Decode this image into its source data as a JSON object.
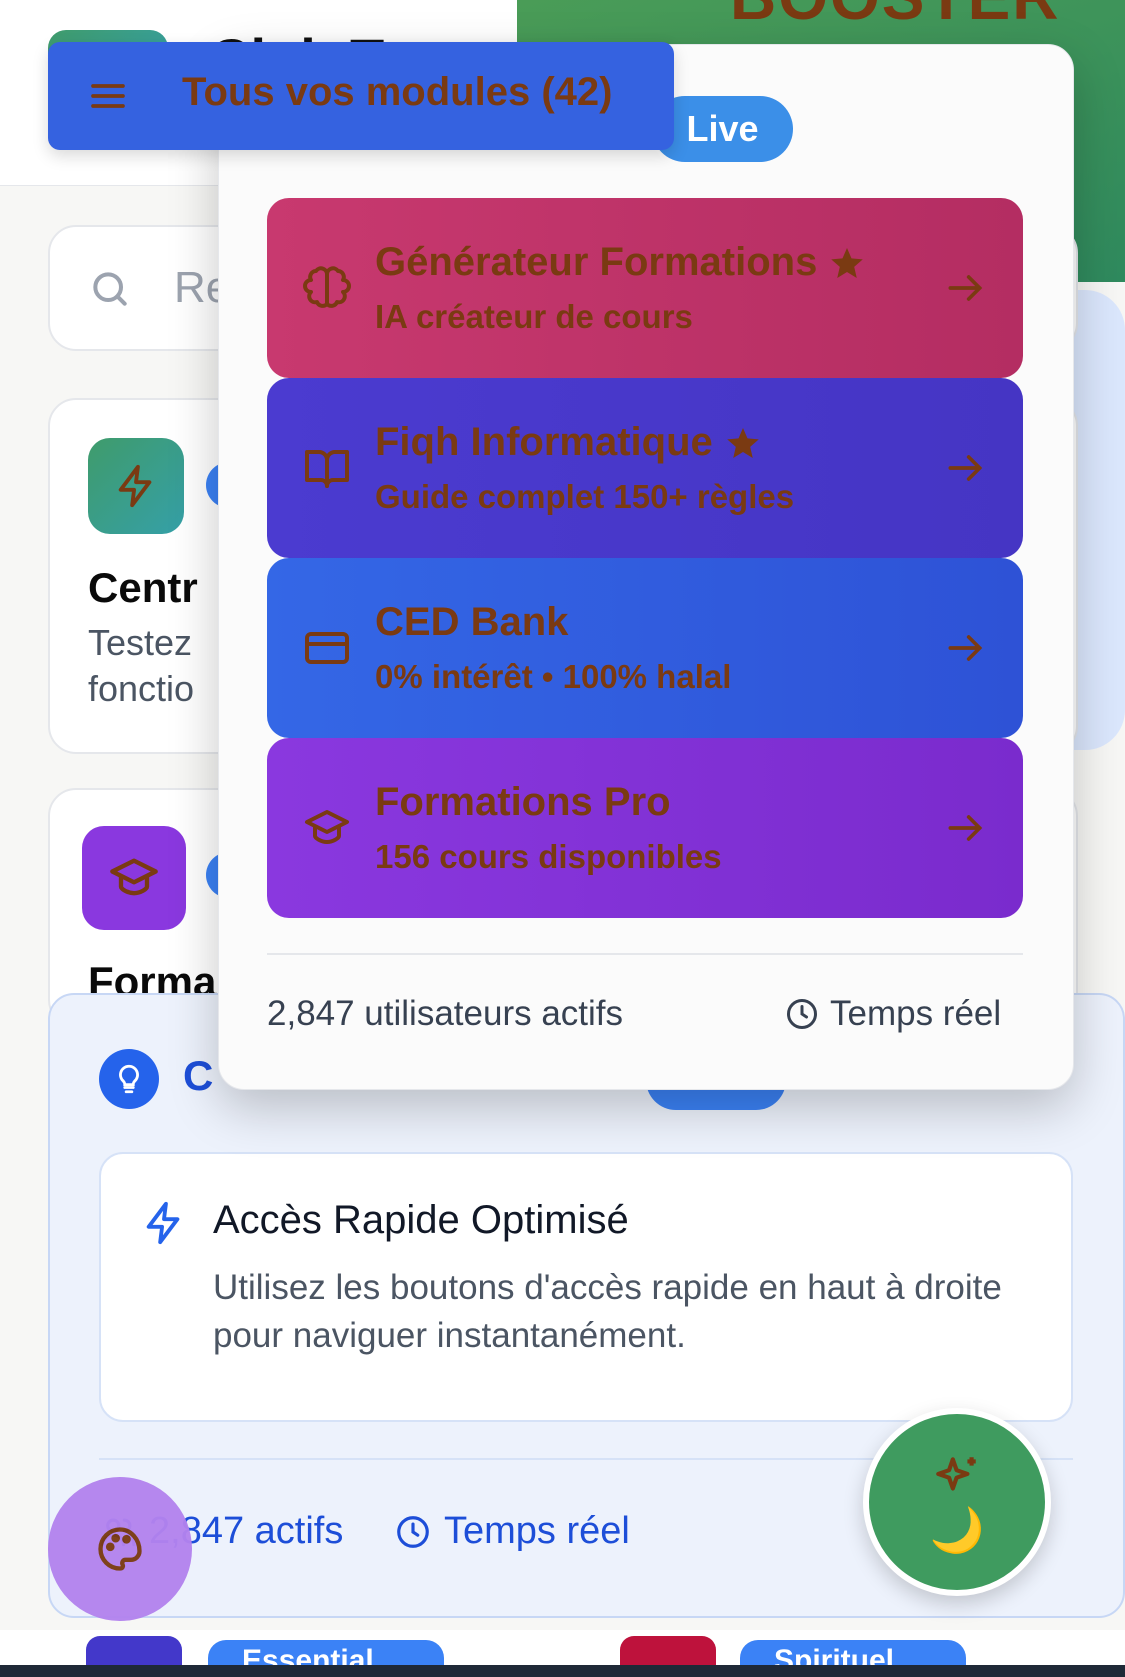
{
  "header": {
    "app_title": "Club T",
    "banner_text": "BOOSTER"
  },
  "search": {
    "placeholder": "Re"
  },
  "cards": [
    {
      "title": "Centr",
      "description": "Testez\nfonctio"
    },
    {
      "title": "Forma"
    }
  ],
  "modules_button": {
    "label": "Tous vos modules (42)"
  },
  "dropdown": {
    "live_badge": "Live",
    "modules": [
      {
        "title": "Générateur Formations",
        "subtitle": "IA créateur de cours",
        "starred": true,
        "icon": "brain-icon"
      },
      {
        "title": "Fiqh Informatique",
        "subtitle": "Guide complet 150+ règles",
        "starred": true,
        "icon": "book-icon"
      },
      {
        "title": "CED Bank",
        "subtitle": "0% intérêt • 100% halal",
        "starred": false,
        "icon": "credit-card-icon"
      },
      {
        "title": "Formations Pro",
        "subtitle": "156 cours disponibles",
        "starred": false,
        "icon": "graduation-cap-icon"
      }
    ],
    "footer": {
      "users": "2,847 utilisateurs actifs",
      "realtime": "Temps réel"
    }
  },
  "tip": {
    "heading": "C",
    "card_title": "Accès Rapide Optimisé",
    "card_body": "Utilisez les boutons d'accès rapide en haut à droite pour naviguer instantanément.",
    "active": "2,847 actifs",
    "realtime": "Temps réel"
  },
  "bottom_badges": {
    "a": "Essential",
    "b": "Spirituel"
  },
  "fab": {
    "moon": "🌙"
  },
  "colors": {
    "primary_blue": "#3562e0",
    "module_pink": "#c8396f",
    "module_indigo": "#4b3bd0",
    "module_blue": "#3467e6",
    "module_purple": "#8a38df",
    "label_brown": "#7a3a12",
    "green": "#3f9b5f"
  }
}
